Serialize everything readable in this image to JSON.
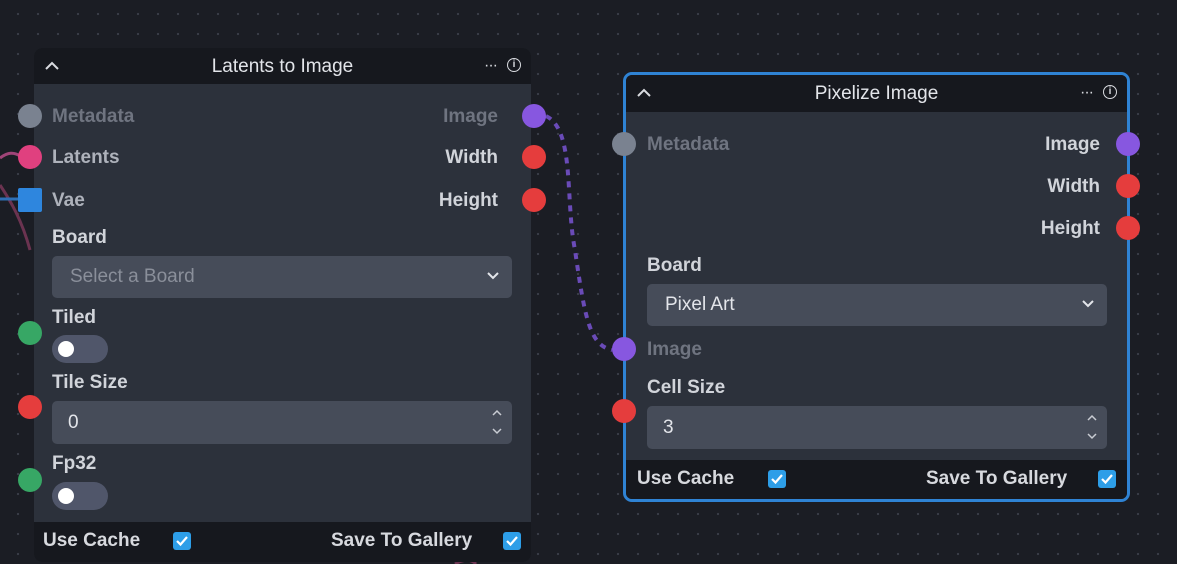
{
  "colors": {
    "canvas": "#1b1d24",
    "node_body": "#2c313b",
    "node_header": "#16181e",
    "selected_border": "#2f83d4",
    "metadata_port": "#7a8290",
    "latents_port": "#e0407f",
    "vae_port": "#2e86de",
    "image_port": "#8757e0",
    "integer_port": "#e53d3d",
    "boolean_port": "#37a765",
    "checkbox": "#2d9ee8"
  },
  "nodes": [
    {
      "title": "Latents to Image",
      "selected": false,
      "inputs": [
        {
          "label": "Metadata",
          "type": "metadata"
        },
        {
          "label": "Latents",
          "type": "latents"
        },
        {
          "label": "Vae",
          "type": "vae"
        }
      ],
      "outputs": [
        {
          "label": "Image",
          "type": "image"
        },
        {
          "label": "Width",
          "type": "integer"
        },
        {
          "label": "Height",
          "type": "integer"
        }
      ],
      "fields": {
        "board_label": "Board",
        "board_placeholder": "Select a Board",
        "tiled_label": "Tiled",
        "tiled_value": false,
        "tile_size_label": "Tile Size",
        "tile_size_value": "0",
        "fp32_label": "Fp32",
        "fp32_value": false
      },
      "footer": {
        "use_cache_label": "Use Cache",
        "use_cache": true,
        "save_label": "Save To Gallery",
        "save": true
      }
    },
    {
      "title": "Pixelize Image",
      "selected": true,
      "inputs": [
        {
          "label": "Metadata",
          "type": "metadata"
        }
      ],
      "outputs": [
        {
          "label": "Image",
          "type": "image"
        },
        {
          "label": "Width",
          "type": "integer"
        },
        {
          "label": "Height",
          "type": "integer"
        }
      ],
      "fields": {
        "board_label": "Board",
        "board_value": "Pixel Art",
        "image_label": "Image",
        "cell_size_label": "Cell Size",
        "cell_size_value": "3"
      },
      "footer": {
        "use_cache_label": "Use Cache",
        "use_cache": true,
        "save_label": "Save To Gallery",
        "save": true
      }
    }
  ],
  "icons": {
    "collapse": "chevron-up-icon",
    "menu": "more-horizontal-icon",
    "info": "info-icon",
    "dropdown": "chevron-down-icon",
    "stepper_up": "chevron-up-small-icon",
    "stepper_down": "chevron-down-small-icon",
    "check": "check-icon"
  },
  "info_glyph": "i",
  "menu_glyph": "···"
}
